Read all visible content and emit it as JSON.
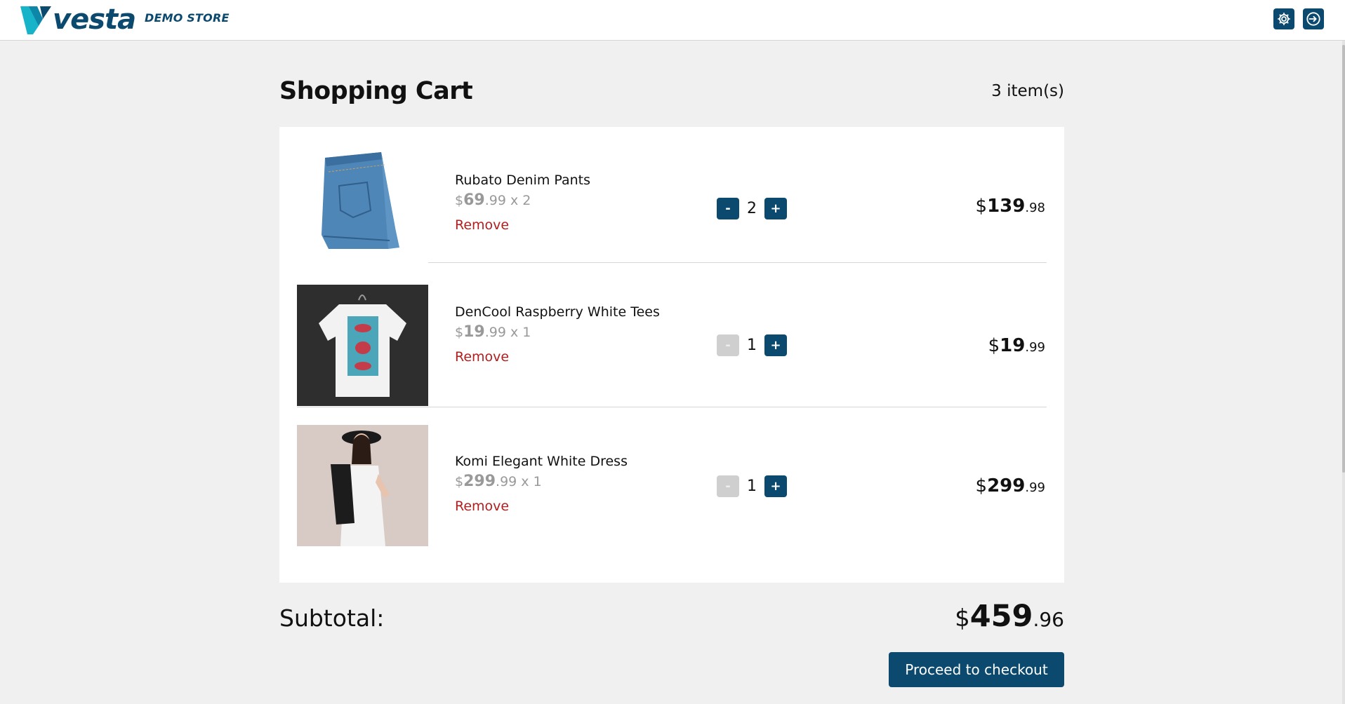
{
  "header": {
    "logo_text": "vesta",
    "store_label": "DEMO STORE",
    "settings_icon": "gear-icon",
    "signin_icon": "sign-in-icon"
  },
  "cart": {
    "title": "Shopping Cart",
    "item_count": "3 item(s)",
    "items": [
      {
        "name": "Rubato Denim Pants",
        "unit_currency": "$",
        "unit_whole": "69",
        "unit_cents": ".99",
        "unit_qty_text": " x 2",
        "remove_label": "Remove",
        "qty": "2",
        "qty_minus": "-",
        "qty_plus": "+",
        "total_currency": "$",
        "total_whole": "139",
        "total_cents": ".98",
        "image": "denim-pants-image"
      },
      {
        "name": "DenCool Raspberry White Tees",
        "unit_currency": "$",
        "unit_whole": "19",
        "unit_cents": ".99",
        "unit_qty_text": " x 1",
        "remove_label": "Remove",
        "qty": "1",
        "qty_minus": "-",
        "qty_plus": "+",
        "total_currency": "$",
        "total_whole": "19",
        "total_cents": ".99",
        "image": "white-tee-image"
      },
      {
        "name": "Komi Elegant White Dress",
        "unit_currency": "$",
        "unit_whole": "299",
        "unit_cents": ".99",
        "unit_qty_text": " x 1",
        "remove_label": "Remove",
        "qty": "1",
        "qty_minus": "-",
        "qty_plus": "+",
        "total_currency": "$",
        "total_whole": "299",
        "total_cents": ".99",
        "image": "white-dress-image"
      }
    ]
  },
  "summary": {
    "subtotal_label": "Subtotal:",
    "subtotal_currency": "$",
    "subtotal_whole": "459",
    "subtotal_cents": ".96",
    "checkout_label": "Proceed to checkout"
  },
  "colors": {
    "brand": "#0b4a6e",
    "accent_cyan": "#17b3c9",
    "remove_red": "#b21e1e",
    "page_bg": "#f0f0f0"
  }
}
